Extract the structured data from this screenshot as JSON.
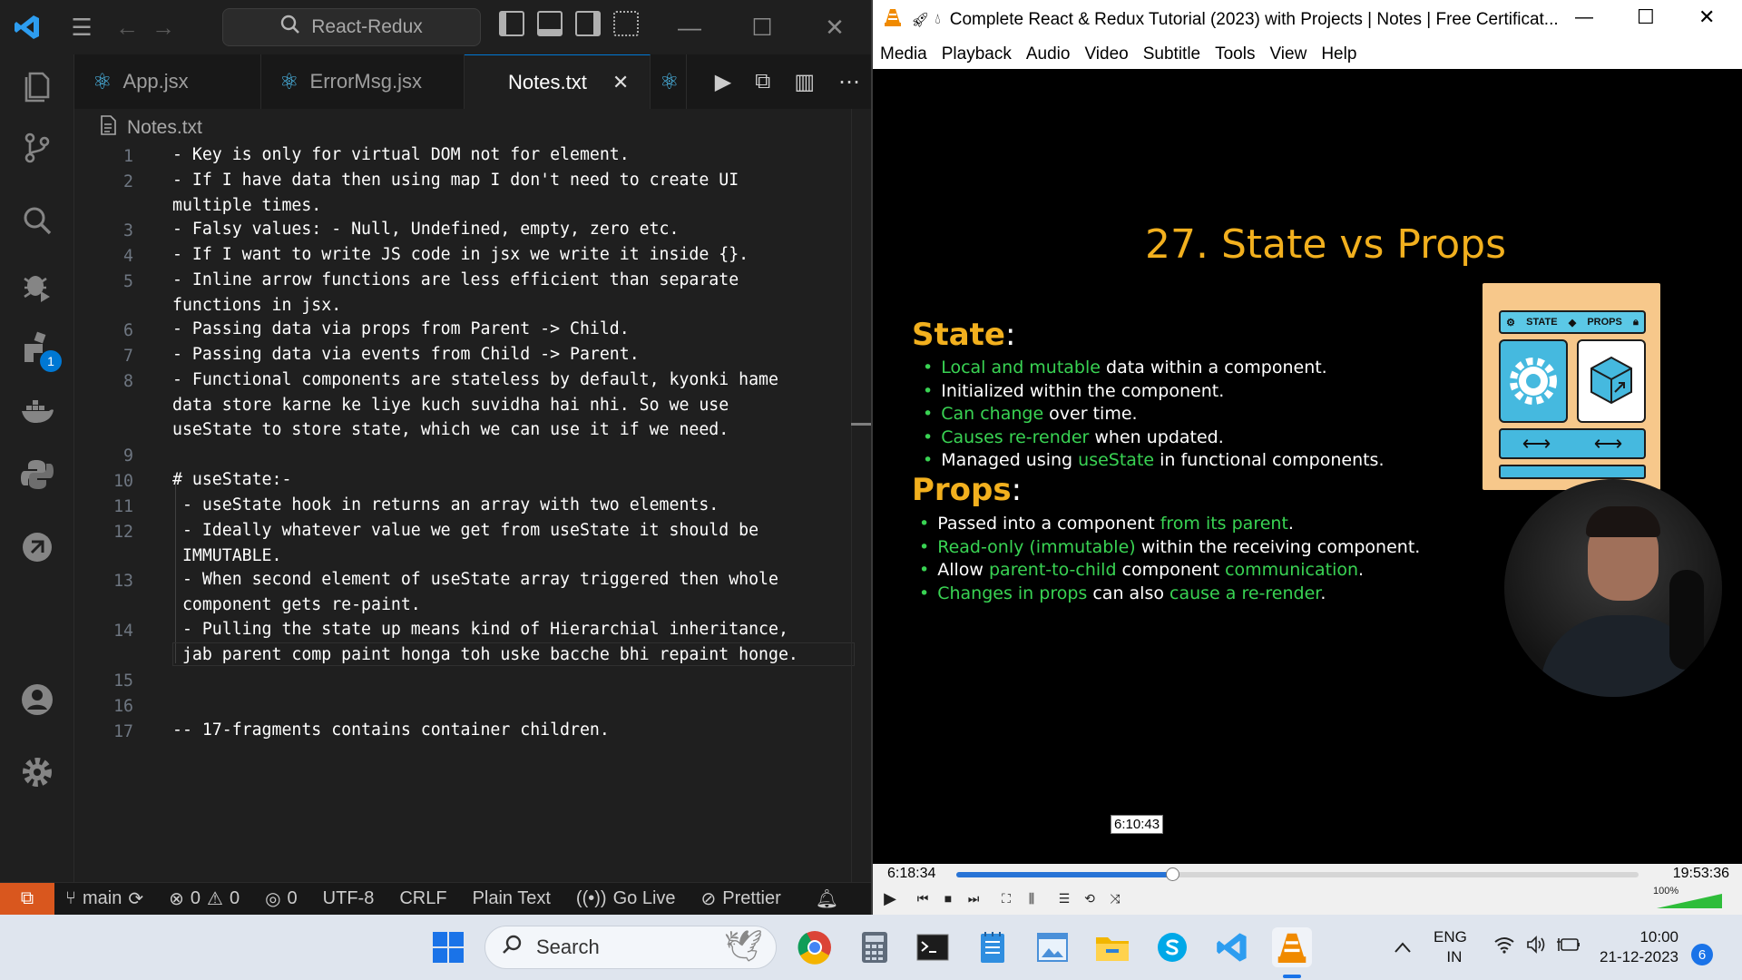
{
  "vscode": {
    "search_text": "React-Redux",
    "tabs": [
      {
        "label": "App.jsx"
      },
      {
        "label": "ErrorMsg.jsx"
      },
      {
        "label": "Notes.txt"
      }
    ],
    "breadcrumb": "Notes.txt",
    "extensions_badge": "1",
    "lines": [
      {
        "num": "1",
        "text": "- Key is only for virtual DOM not for element."
      },
      {
        "num": "2",
        "text": "- If I have data then using map I don't need to create UI\nmultiple times."
      },
      {
        "num": "3",
        "text": "- Falsy values: - Null, Undefined, empty, zero etc."
      },
      {
        "num": "4",
        "text": "- If I want to write JS code in jsx we write it inside {}."
      },
      {
        "num": "5",
        "text": "- Inline arrow functions are less efficient than separate\nfunctions in jsx."
      },
      {
        "num": "6",
        "text": "- Passing data via props from Parent -> Child."
      },
      {
        "num": "7",
        "text": "- Passing data via events from Child -> Parent."
      },
      {
        "num": "8",
        "text": "- Functional components are stateless by default, kyonki hame\ndata store karne ke liye kuch suvidha hai nhi. So we use\nuseState to store state, which we can use it if we need."
      },
      {
        "num": "9",
        "text": ""
      },
      {
        "num": "10",
        "text": "# useState:-"
      },
      {
        "num": "11",
        "text": " - useState hook in returns an array with two elements."
      },
      {
        "num": "12",
        "text": " - Ideally whatever value we get from useState it should be\n IMMUTABLE."
      },
      {
        "num": "13",
        "text": " - When second element of useState array triggered then whole\n component gets re-paint."
      },
      {
        "num": "14",
        "text": " - Pulling the state up means kind of Hierarchial inheritance,\n jab parent comp paint honga toh uske bacche bhi repaint honge."
      },
      {
        "num": "15",
        "text": ""
      },
      {
        "num": "16",
        "text": ""
      },
      {
        "num": "17",
        "text": "-- 17-fragments contains container children."
      }
    ],
    "status": {
      "branch": "main",
      "errors": "0",
      "warnings": "0",
      "ports": "0",
      "encoding": "UTF-8",
      "eol": "CRLF",
      "language": "Plain Text",
      "live": "Go Live",
      "prettier": "Prettier"
    }
  },
  "vlc": {
    "title": "Complete React & Redux Tutorial (2023) with Projects | Notes | Free Certificat...",
    "menu": [
      "Media",
      "Playback",
      "Audio",
      "Video",
      "Subtitle",
      "Tools",
      "View",
      "Help"
    ],
    "slide": {
      "title": "27. State vs Props",
      "state_heading": "State",
      "props_heading": "Props",
      "art_state": "STATE",
      "art_props": "PROPS"
    },
    "tooltip_time": "6:10:43",
    "elapsed": "6:18:34",
    "total": "19:53:36",
    "progress": 0.317,
    "volume": "100%"
  },
  "taskbar": {
    "search_label": "Search",
    "lang_top": "ENG",
    "lang_bottom": "IN",
    "time": "10:00",
    "date": "21-12-2023",
    "notifications": "6"
  },
  "colors": {
    "accent_blue": "#0078d4",
    "slide_orange": "#f2b01e",
    "slide_green": "#39d353",
    "remote_orange": "#d9571e"
  }
}
